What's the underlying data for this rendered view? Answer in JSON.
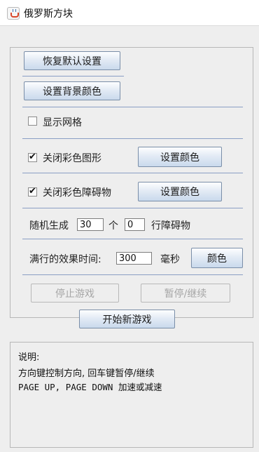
{
  "window": {
    "title": "俄罗斯方块",
    "icon": "java-cup-icon"
  },
  "controls": {
    "restore_defaults": "恢复默认设置",
    "set_background_color": "设置背景颜色",
    "show_grid": {
      "label": "显示网格",
      "checked": false
    },
    "disable_color_shapes": {
      "label": "关闭彩色图形",
      "checked": true,
      "button": "设置颜色"
    },
    "disable_color_obstacles": {
      "label": "关闭彩色障碍物",
      "checked": true,
      "button": "设置颜色"
    },
    "random_gen": {
      "prefix": "随机生成",
      "count_value": "30",
      "count_unit": "个",
      "rows_value": "0",
      "rows_suffix": "行障碍物"
    },
    "clear_effect": {
      "label": "满行的效果时间:",
      "value": "300",
      "unit": "毫秒",
      "color_button": "颜色"
    },
    "stop_game": "停止游戏",
    "pause_resume": "暂停/继续",
    "new_game": "开始新游戏"
  },
  "help": {
    "heading": "说明:",
    "line1": "方向键控制方向, 回车键暂停/继续",
    "line2": "PAGE UP, PAGE DOWN 加速或减速"
  },
  "colors": {
    "accent_separator": "#8a9ec4",
    "button_border": "#7a8ea8"
  }
}
